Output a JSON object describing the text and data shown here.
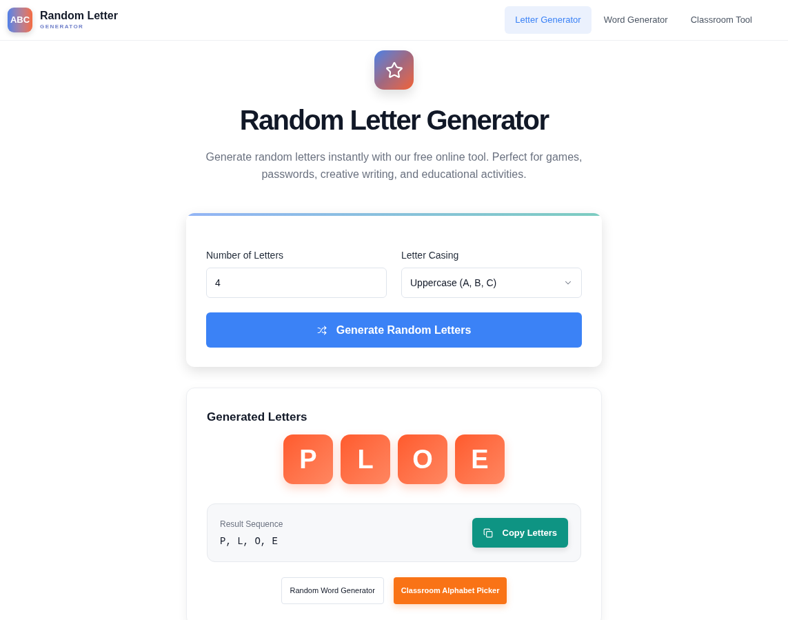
{
  "header": {
    "logo": {
      "mark": "ABC",
      "title": "Random Letter",
      "subtitle": "GENERATOR"
    },
    "nav": [
      {
        "label": "Letter Generator",
        "selected": true
      },
      {
        "label": "Word Generator",
        "selected": false
      },
      {
        "label": "Classroom Tool",
        "selected": false
      }
    ]
  },
  "hero": {
    "title": "Random Letter Generator",
    "description": "Generate random letters instantly with our free online tool. Perfect for games, passwords, creative writing, and educational activities."
  },
  "form": {
    "fields": [
      {
        "kind": "number",
        "label": "Number of Letters",
        "value": "4"
      },
      {
        "kind": "select",
        "label": "Letter Casing",
        "value": "Uppercase (A, B, C)"
      }
    ],
    "button": "Generate Random Letters"
  },
  "results": {
    "title": "Generated Letters",
    "letters": [
      "P",
      "L",
      "O",
      "E"
    ],
    "sequence": {
      "label": "Result Sequence",
      "value": "P, L, O, E"
    },
    "copy_button": "Copy Letters"
  },
  "links": [
    {
      "kind": "outline",
      "label": "Random Word Generator"
    },
    {
      "kind": "filled",
      "label": "Classroom Alphabet Picker"
    }
  ]
}
